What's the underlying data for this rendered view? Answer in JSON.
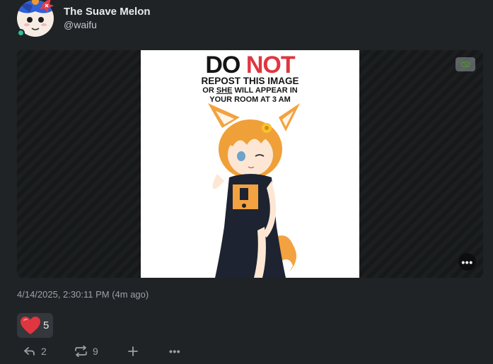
{
  "user": {
    "display_name": "The Suave Melon",
    "username": "@waifu",
    "status_color": "#2fbf9a"
  },
  "media": {
    "poster": {
      "word_do": "DO",
      "word_not": "NOT",
      "line2": "REPOST THIS IMAGE",
      "line3_prefix": "OR ",
      "line3_emph": "SHE",
      "line3_suffix": " WILL APPEAR IN",
      "line4": "YOUR ROOM AT 3 AM"
    },
    "sensitive_icon": "eye-slash-icon",
    "more_icon": "ellipsis-icon",
    "more_glyph": "•••"
  },
  "timestamp": "4/14/2025, 2:30:11 PM (4m ago)",
  "reaction": {
    "icon": "heart-icon",
    "count": "5",
    "color": "#e0363f"
  },
  "footer": {
    "reply_count": "2",
    "renote_count": "9",
    "more_glyph": "•••"
  }
}
